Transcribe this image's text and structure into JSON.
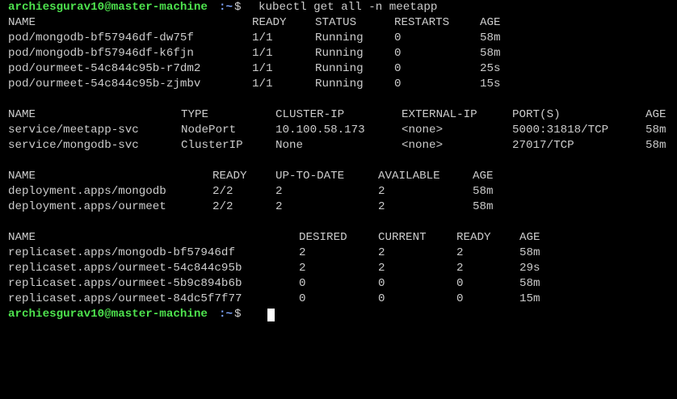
{
  "colors": {
    "background": "#000000",
    "text": "#cccccc",
    "prompt_user": "#4ee44e",
    "prompt_path": "#7fa7ff",
    "cursor": "#ffffff"
  },
  "prompt1": {
    "user_host": "archiesgurav10@master-machine",
    "path": ":~",
    "symbol": "$",
    "command": "kubectl get all -n meetapp"
  },
  "pods": {
    "headers": [
      "NAME",
      "READY",
      "STATUS",
      "RESTARTS",
      "AGE"
    ],
    "rows": [
      [
        "pod/mongodb-bf57946df-dw75f",
        "1/1",
        "Running",
        "0",
        "58m"
      ],
      [
        "pod/mongodb-bf57946df-k6fjn",
        "1/1",
        "Running",
        "0",
        "58m"
      ],
      [
        "pod/ourmeet-54c844c95b-r7dm2",
        "1/1",
        "Running",
        "0",
        "25s"
      ],
      [
        "pod/ourmeet-54c844c95b-zjmbv",
        "1/1",
        "Running",
        "0",
        "15s"
      ]
    ]
  },
  "services": {
    "headers": [
      "NAME",
      "TYPE",
      "CLUSTER-IP",
      "EXTERNAL-IP",
      "PORT(S)",
      "AGE"
    ],
    "rows": [
      [
        "service/meetapp-svc",
        "NodePort",
        "10.100.58.173",
        "<none>",
        "5000:31818/TCP",
        "58m"
      ],
      [
        "service/mongodb-svc",
        "ClusterIP",
        "None",
        "<none>",
        "27017/TCP",
        "58m"
      ]
    ]
  },
  "deployments": {
    "headers": [
      "NAME",
      "READY",
      "UP-TO-DATE",
      "AVAILABLE",
      "AGE"
    ],
    "rows": [
      [
        "deployment.apps/mongodb",
        "2/2",
        "2",
        "2",
        "58m"
      ],
      [
        "deployment.apps/ourmeet",
        "2/2",
        "2",
        "2",
        "58m"
      ]
    ]
  },
  "replicasets": {
    "headers": [
      "NAME",
      "DESIRED",
      "CURRENT",
      "READY",
      "AGE"
    ],
    "rows": [
      [
        "replicaset.apps/mongodb-bf57946df",
        "2",
        "2",
        "2",
        "58m"
      ],
      [
        "replicaset.apps/ourmeet-54c844c95b",
        "2",
        "2",
        "2",
        "29s"
      ],
      [
        "replicaset.apps/ourmeet-5b9c894b6b",
        "0",
        "0",
        "0",
        "58m"
      ],
      [
        "replicaset.apps/ourmeet-84dc5f7f77",
        "0",
        "0",
        "0",
        "15m"
      ]
    ]
  },
  "prompt2": {
    "user_host": "archiesgurav10@master-machine",
    "path": ":~",
    "symbol": "$"
  }
}
